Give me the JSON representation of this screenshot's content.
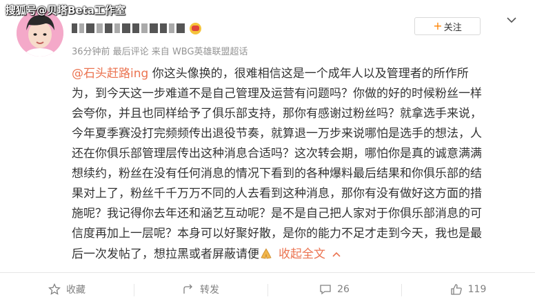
{
  "watermark": "搜狐号@贝塔Beta工作室",
  "post": {
    "username": "",
    "meta": "36分钟前  最后评论  来自 WBG英雄联盟超话",
    "follow_label": "关注",
    "content": {
      "mention": "@石头赶路ing",
      "line1_rest": " 你这头像换的，很难相信这是一个成年人以及管理者的所作所",
      "line2": "为，到今天这一步难道不是自己管理及运营有问题吗？你做的好的时候粉丝一样",
      "line3": "会夸你，并且也同样给予了俱乐部支持，那你有感谢过粉丝吗？就拿选手来说，",
      "line4": "今年夏季赛没打完频频传出退役节奏，就算退一万步来说哪怕是选手的想法，人",
      "line5": "还在你俱乐部管理层传出这种消息合适吗？这次转会期，哪怕你是真的诚意满满",
      "line6": "想续约，粉丝在没有任何消息的情况下看到的各种爆料最后结果和你俱乐部的结",
      "line7": "果对上了，粉丝千千万万不同的人去看到这种消息，那你有没有做好这方面的措",
      "line8": "施呢？我记得你去年还和涵艺互动呢？是不是自己把人家对于你俱乐部消息的可",
      "line9": "信度再加上一层呢？本身可以好聚好散，是你的能力不足才走到今天，我也是最",
      "line10": "后一次发帖了，想拉黑或者屏蔽请便",
      "emoji_icon": "folded-hands-icon",
      "collapse_label": "收起全文"
    }
  },
  "actions": {
    "favorite_label": "收藏",
    "repost_label": "转发",
    "comment_count": "26",
    "like_count": "119"
  },
  "colors": {
    "accent": "#eb7350",
    "follow_plus": "#ff8200",
    "meta_gray": "#939393"
  }
}
